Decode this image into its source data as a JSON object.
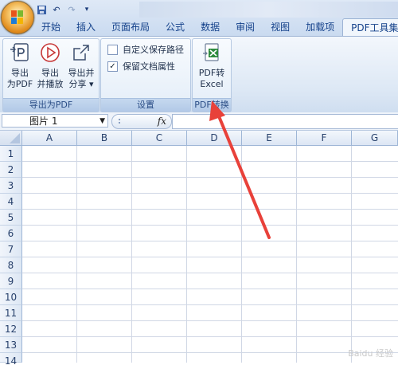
{
  "quick_access": {
    "icons": [
      "save-icon",
      "undo-icon",
      "redo-icon",
      "customize-icon"
    ]
  },
  "tabs": [
    "开始",
    "插入",
    "页面布局",
    "公式",
    "数据",
    "审阅",
    "视图",
    "加载项",
    "PDF工具集"
  ],
  "active_tab": "PDF工具集",
  "ribbon": {
    "export_group": {
      "label": "导出为PDF",
      "buttons": [
        {
          "line1": "导出",
          "line2": "为PDF"
        },
        {
          "line1": "导出",
          "line2": "并播放"
        },
        {
          "line1": "导出并",
          "line2": "分享 ▾"
        }
      ]
    },
    "settings_group": {
      "label": "设置",
      "checkboxes": [
        {
          "label": "自定义保存路径",
          "checked": false
        },
        {
          "label": "保留文档属性",
          "checked": true
        }
      ]
    },
    "convert_group": {
      "label": "PDF转换",
      "button": {
        "line1": "PDF转",
        "line2": "Excel"
      }
    }
  },
  "formula_bar": {
    "name_box": "图片 1",
    "fx_label": "fx",
    "formula": ""
  },
  "sheet": {
    "columns": [
      "A",
      "B",
      "C",
      "D",
      "E",
      "F",
      "G"
    ],
    "rows": [
      "1",
      "2",
      "3",
      "4",
      "5",
      "6",
      "7",
      "8",
      "9",
      "10",
      "11",
      "12",
      "13",
      "14"
    ]
  },
  "annotation": {
    "arrow_color": "#e8413a"
  },
  "watermark": "Baidu 经验"
}
